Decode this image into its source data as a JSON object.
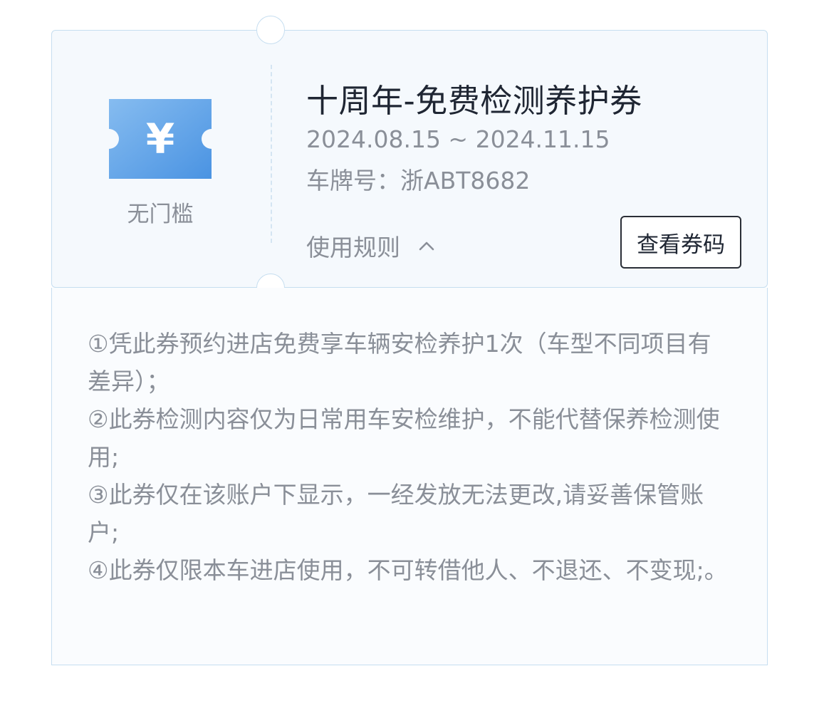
{
  "coupon": {
    "icon_symbol": "¥",
    "threshold_label": "无门槛",
    "title": "十周年-免费检测养护券",
    "date_range": "2024.08.15 ~ 2024.11.15",
    "plate_label": "车牌号：",
    "plate_value": "浙ABT8682",
    "rules_toggle_label": "使用规则",
    "view_code_label": "查看券码"
  },
  "rules": [
    "①凭此券预约进店免费享车辆安检养护1次（车型不同项目有差异）；",
    "②此券检测内容仅为日常用车安检维护，不能代替保养检测使用;",
    "③此券仅在该账户下显示，一经发放无法更改,请妥善保管账户;",
    "④此券仅限本车进店使用，不可转借他人、不退还、不变现;。"
  ],
  "colors": {
    "ticket_gradient_start": "#7fb6ee",
    "ticket_gradient_end": "#4f97e4",
    "card_border": "#c6def0",
    "text_muted": "#8a8f98",
    "text_dark": "#1f2633"
  }
}
